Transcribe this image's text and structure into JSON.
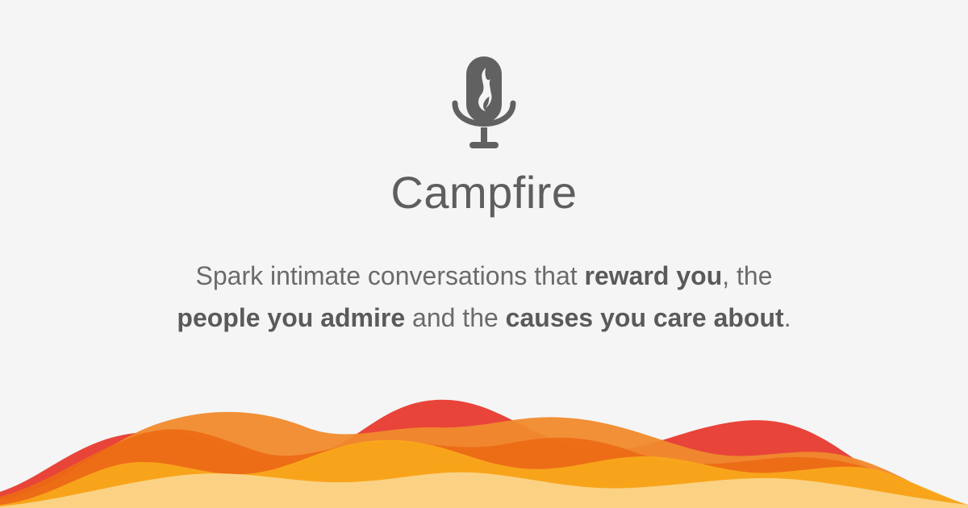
{
  "brand": {
    "name": "Campfire",
    "icon": "microphone-flame-icon"
  },
  "tagline": {
    "part1": "Spark intimate conversations that ",
    "emph1": "reward you",
    "part2": ", the ",
    "emph2": "people you admire",
    "part3": " and the ",
    "emph3": "causes you care about",
    "part4": "."
  },
  "colors": {
    "background": "#f5f5f5",
    "text": "#5e5e5e",
    "wave_red": "#e8443a",
    "wave_orange_dark": "#ec6a14",
    "wave_orange": "#f08a2c",
    "wave_amber": "#f8a91c",
    "wave_sand": "#fbd58a"
  }
}
